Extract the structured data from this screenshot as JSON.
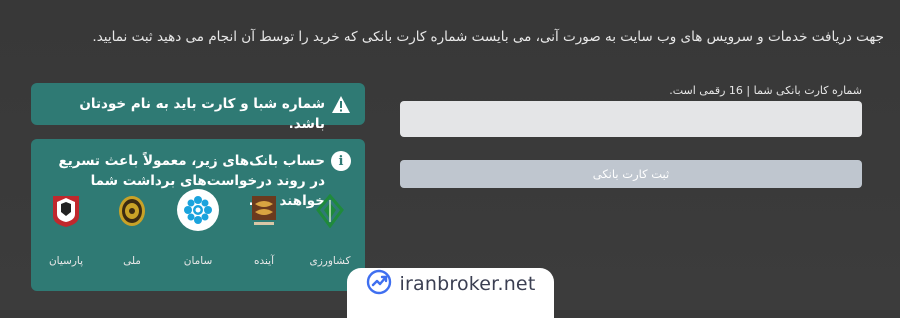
{
  "intro_text": "جهت دریافت خدمات و سرویس های وب سایت به صورت آنی، می بایست شماره کارت بانکی که خرید را توسط آن انجام می دهید ثبت نمایید.",
  "form": {
    "card_label": "شماره کارت بانکی شما | 16 رقمی است.",
    "card_value": "",
    "submit_label": "ثبت کارت بانکی"
  },
  "alerts": {
    "warning_text": "شماره شبا و کارت باید به نام خودتان باشد.",
    "info_text": "حساب بانک‌های زیر، معمولاً باعث تسریع در روند درخواست‌های برداشت شما خواهند شد."
  },
  "banks": [
    {
      "name": "پارسیان",
      "icon": "parsian-bank-logo",
      "color": "#c0282d"
    },
    {
      "name": "ملی",
      "icon": "melli-bank-logo",
      "color": "#c9a227"
    },
    {
      "name": "سامان",
      "icon": "saman-bank-logo",
      "color": "#1aa3dd"
    },
    {
      "name": "آینده",
      "icon": "ayandeh-bank-logo",
      "color": "#6b3a1e"
    },
    {
      "name": "کشاورزی",
      "icon": "keshavarzi-bank-logo",
      "color": "#1f8a3b"
    }
  ],
  "watermark": {
    "text": "iranbroker.net"
  },
  "colors": {
    "background": "#3a3a3a",
    "alert_bg": "#2f7a74",
    "button_bg": "#bfc6cf",
    "input_bg": "#e4e5e7"
  }
}
